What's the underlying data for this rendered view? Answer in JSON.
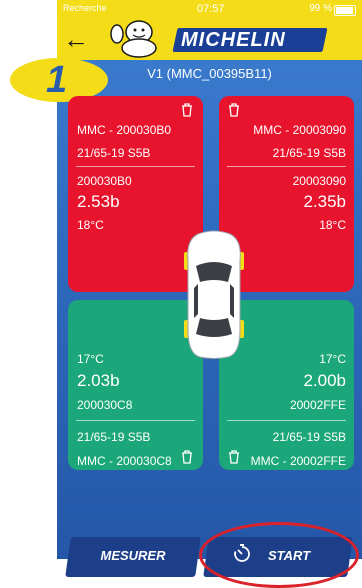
{
  "status_bar": {
    "carrier": "Recherche",
    "time": "07:57",
    "battery": "99 %"
  },
  "header": {
    "brand": "MICHELIN",
    "step_number": "1",
    "vehicle_title": "V1 (MMC_00395B11)"
  },
  "tires": {
    "front_left": {
      "sensor_name": "MMC - 200030B0",
      "size": "21/65-19 S5B",
      "sensor_id": "200030B0",
      "pressure": "2.53b",
      "temperature": "18°C",
      "status_color": "#e8142e"
    },
    "front_right": {
      "sensor_name": "MMC - 20003090",
      "size": "21/65-19 S5B",
      "sensor_id": "20003090",
      "pressure": "2.35b",
      "temperature": "18°C",
      "status_color": "#e8142e"
    },
    "rear_left": {
      "temperature": "17°C",
      "pressure": "2.03b",
      "sensor_id": "200030C8",
      "size": "21/65-19 S5B",
      "sensor_name": "MMC - 200030C8",
      "status_color": "#1ba77a"
    },
    "rear_right": {
      "temperature": "17°C",
      "pressure": "2.00b",
      "sensor_id": "20002FFE",
      "size": "21/65-19 S5B",
      "sensor_name": "MMC - 20002FFE",
      "status_color": "#1ba77a"
    }
  },
  "footer": {
    "measure_label": "MESURER",
    "start_label": "START"
  },
  "icons": {
    "back": "back-arrow-icon",
    "delete": "trash-icon",
    "timer": "timer-icon",
    "car": "car-top-view-icon",
    "mascot": "michelin-man-logo"
  }
}
